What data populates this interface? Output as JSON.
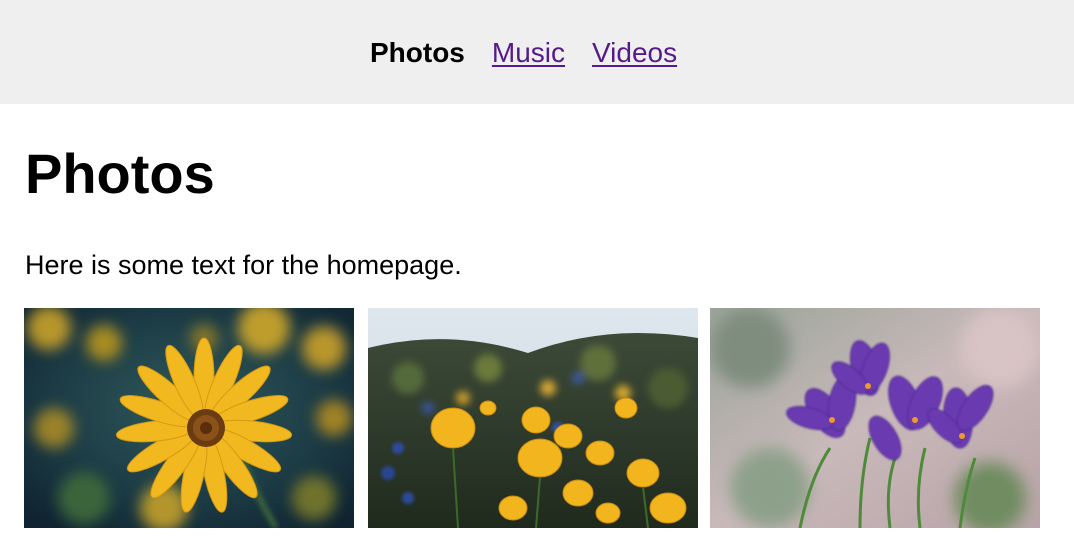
{
  "nav": {
    "items": [
      {
        "label": "Photos",
        "current": true
      },
      {
        "label": "Music",
        "current": false
      },
      {
        "label": "Videos",
        "current": false
      }
    ],
    "link_color": "#551a8b",
    "bar_color": "#efefef"
  },
  "main": {
    "title": "Photos",
    "intro": "Here is some text for the homepage."
  },
  "gallery": {
    "photos": [
      {
        "subject": "yellow-daisy-photo"
      },
      {
        "subject": "yellow-poppies-field-photo"
      },
      {
        "subject": "purple-crocus-photo"
      }
    ]
  }
}
